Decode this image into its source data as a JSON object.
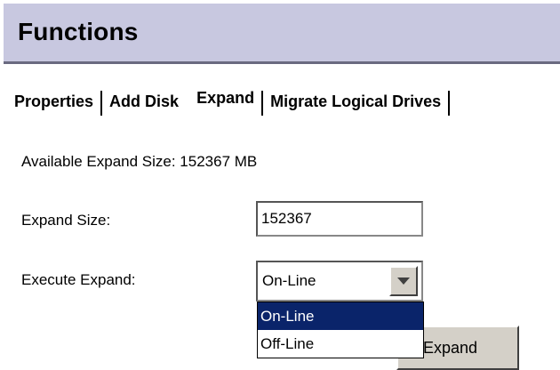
{
  "header": {
    "title": "Functions"
  },
  "tabs": [
    {
      "label": "Properties",
      "active": false
    },
    {
      "label": "Add Disk",
      "active": false
    },
    {
      "label": "Expand",
      "active": true
    },
    {
      "label": "Migrate Logical Drives",
      "active": false
    }
  ],
  "available": {
    "text": "Available Expand Size: 152367 MB"
  },
  "expand_size": {
    "label": "Expand Size:",
    "value": "152367"
  },
  "execute_expand": {
    "label": "Execute Expand:",
    "selected": "On-Line",
    "options": [
      "On-Line",
      "Off-Line"
    ],
    "highlighted_option": "On-Line"
  },
  "actions": {
    "expand_label": "Expand"
  },
  "colors": {
    "header_bg": "#c8c8e0",
    "selection_bg": "#0a246a",
    "button_face": "#d4d0c8"
  },
  "icons": {
    "dropdown": "chevron-down-icon"
  }
}
